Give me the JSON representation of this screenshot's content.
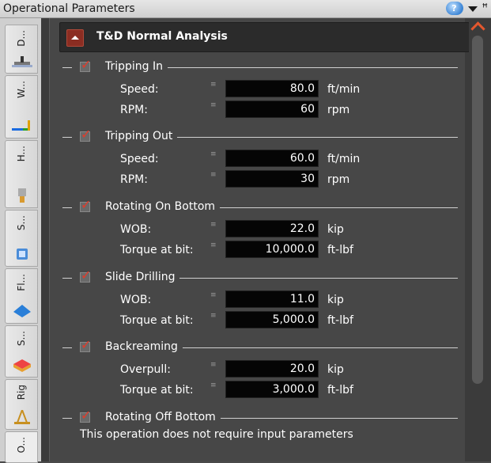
{
  "window": {
    "title": "Operational Parameters"
  },
  "titlebar_icons": [
    "help-icon",
    "dropdown-icon",
    "pin-icon"
  ],
  "left_tabs": [
    {
      "label": "D...",
      "icon": "drilling-icon"
    },
    {
      "label": "W...",
      "icon": "wellbore-icon"
    },
    {
      "label": "H...",
      "icon": "hole-section-icon"
    },
    {
      "label": "S...",
      "icon": "string-icon"
    },
    {
      "label": "Fl...",
      "icon": "fluid-icon"
    },
    {
      "label": "S...",
      "icon": "survey-icon"
    },
    {
      "label": "Rig",
      "icon": "rig-icon"
    },
    {
      "label": "O...",
      "icon": ""
    }
  ],
  "panel": {
    "title": "T&D Normal Analysis",
    "sections": [
      {
        "title": "Tripping In",
        "checked": true,
        "rows": [
          {
            "label": "Speed:",
            "value": "80.0",
            "unit": "ft/min"
          },
          {
            "label": "RPM:",
            "value": "60",
            "unit": "rpm"
          }
        ]
      },
      {
        "title": "Tripping Out",
        "checked": true,
        "rows": [
          {
            "label": "Speed:",
            "value": "60.0",
            "unit": "ft/min"
          },
          {
            "label": "RPM:",
            "value": "30",
            "unit": "rpm"
          }
        ]
      },
      {
        "title": "Rotating On Bottom",
        "checked": true,
        "rows": [
          {
            "label": "WOB:",
            "value": "22.0",
            "unit": "kip"
          },
          {
            "label": "Torque at bit:",
            "value": "10,000.0",
            "unit": "ft-lbf"
          }
        ]
      },
      {
        "title": "Slide Drilling",
        "checked": true,
        "rows": [
          {
            "label": "WOB:",
            "value": "11.0",
            "unit": "kip"
          },
          {
            "label": "Torque at bit:",
            "value": "5,000.0",
            "unit": "ft-lbf"
          }
        ]
      },
      {
        "title": "Backreaming",
        "checked": true,
        "rows": [
          {
            "label": "Overpull:",
            "value": "20.0",
            "unit": "kip"
          },
          {
            "label": "Torque at bit:",
            "value": "3,000.0",
            "unit": "ft-lbf"
          }
        ]
      },
      {
        "title": "Rotating Off Bottom",
        "checked": true,
        "rows": []
      }
    ],
    "note": "This operation does not require input parameters"
  },
  "colors": {
    "accent": "#e23b2a",
    "panel_bg": "#474747",
    "input_bg": "#050505"
  }
}
